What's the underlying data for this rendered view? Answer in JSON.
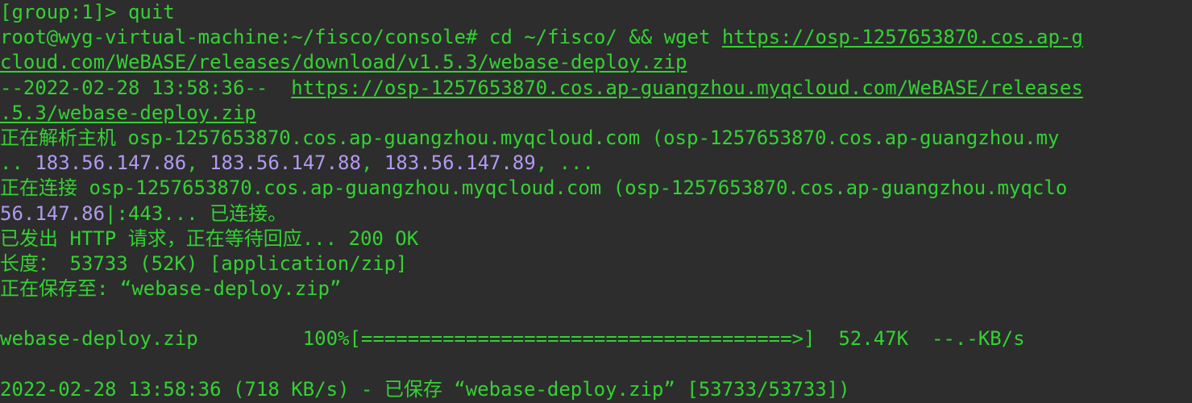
{
  "terminal": {
    "lines": {
      "l1": {
        "text": "[group:1]> quit"
      },
      "l2": {
        "prompt": "root@wyg-virtual-machine:~/fisco/console#",
        "command": " cd ~/fisco/ && wget ",
        "url": "https://osp-1257653870.cos.ap-g"
      },
      "l3": {
        "url": "cloud.com/WeBASE/releases/download/v1.5.3/webase-deploy.zip"
      },
      "l4": {
        "prefix": "--2022-02-28 13:58:36--  ",
        "url": "https://osp-1257653870.cos.ap-guangzhou.myqcloud.com/WeBASE/releases"
      },
      "l5": {
        "url": ".5.3/webase-deploy.zip"
      },
      "l6": {
        "text": "正在解析主机 osp-1257653870.cos.ap-guangzhou.myqcloud.com (osp-1257653870.cos.ap-guangzhou.my"
      },
      "l7": {
        "prefix": ".. ",
        "ip1": "183.56.147.86",
        "sep1": ", ",
        "ip2": "183.56.147.88",
        "sep2": ", ",
        "ip3": "183.56.147.89",
        "suffix": ", ..."
      },
      "l8": {
        "text": "正在连接 osp-1257653870.cos.ap-guangzhou.myqcloud.com (osp-1257653870.cos.ap-guangzhou.myqclo"
      },
      "l9": {
        "ip": "56.147.86",
        "suffix": "|:443... 已连接。"
      },
      "l10": {
        "text": "已发出 HTTP 请求，正在等待回应... 200 OK"
      },
      "l11": {
        "text": "长度： 53733 (52K) [application/zip]"
      },
      "l12": {
        "text": "正在保存至: “webase-deploy.zip”"
      },
      "l14": {
        "text": "webase-deploy.zip         100%[=====================================>]  52.47K  --.-KB/s"
      },
      "l16": {
        "text": "2022-02-28 13:58:36 (718 KB/s) - 已保存 “webase-deploy.zip” [53733/53733])"
      }
    }
  }
}
